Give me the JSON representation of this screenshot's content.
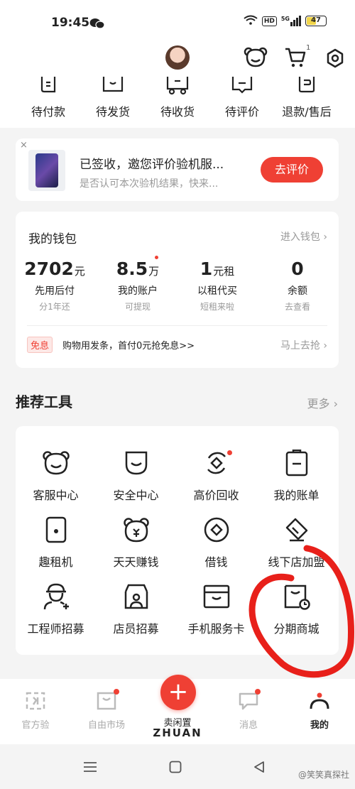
{
  "status": {
    "time": "19:45",
    "hd": "HD",
    "network": "5G",
    "battery": "47"
  },
  "header": {
    "cart_count": "1"
  },
  "orders": [
    {
      "label": "待付款",
      "icon": "wallet-icon"
    },
    {
      "label": "待发货",
      "icon": "box-icon"
    },
    {
      "label": "待收货",
      "icon": "truck-icon"
    },
    {
      "label": "待评价",
      "icon": "comment-icon"
    },
    {
      "label": "退款/售后",
      "icon": "refund-icon"
    }
  ],
  "promo": {
    "close": "×",
    "title": "已签收，邀您评价验机服...",
    "subtitle": "是否认可本次验机结果，快来...",
    "button": "去评价"
  },
  "wallet": {
    "title": "我的钱包",
    "link": "进入钱包 ›",
    "stats": [
      {
        "value": "2702",
        "unit": "元",
        "name": "先用后付",
        "sub": "分1年还"
      },
      {
        "value": "8.5",
        "unit": "万",
        "name": "我的账户",
        "sub": "可提现"
      },
      {
        "value": "1",
        "unit": "元租",
        "name": "以租代买",
        "sub": "短租来啦"
      },
      {
        "value": "0",
        "unit": "",
        "name": "余额",
        "sub": "去查看"
      }
    ],
    "free_tag": "免息",
    "free_text": "购物用发条，首付0元抢免息>>",
    "free_link": "马上去抢 ›"
  },
  "tools": {
    "title": "推荐工具",
    "more": "更多 ›",
    "items": [
      {
        "label": "客服中心",
        "icon": "bear-service-icon"
      },
      {
        "label": "安全中心",
        "icon": "shield-icon"
      },
      {
        "label": "高价回收",
        "icon": "recycle-icon"
      },
      {
        "label": "我的账单",
        "icon": "bill-icon"
      },
      {
        "label": "趣租机",
        "icon": "phone-rent-icon"
      },
      {
        "label": "天天赚钱",
        "icon": "bear-coin-icon"
      },
      {
        "label": "借钱",
        "icon": "coin-icon"
      },
      {
        "label": "线下店加盟",
        "icon": "handshake-icon"
      },
      {
        "label": "工程师招募",
        "icon": "engineer-icon"
      },
      {
        "label": "店员招募",
        "icon": "clerk-icon"
      },
      {
        "label": "手机服务卡",
        "icon": "card-icon"
      },
      {
        "label": "分期商城",
        "icon": "installment-icon"
      }
    ]
  },
  "tabbar": {
    "items": [
      {
        "label": "官方验",
        "icon": "official-check-icon"
      },
      {
        "label": "自由市场",
        "icon": "market-icon"
      },
      {
        "label": "卖闲置",
        "icon": "plus-icon"
      },
      {
        "label": "消息",
        "icon": "message-icon"
      },
      {
        "label": "我的",
        "icon": "mine-icon"
      }
    ],
    "sell_plus": "+",
    "brand": "ZHUAN"
  },
  "watermark": "@笑笑真探社",
  "colors": {
    "accent": "#ef4034",
    "annotation": "#e8201a"
  }
}
